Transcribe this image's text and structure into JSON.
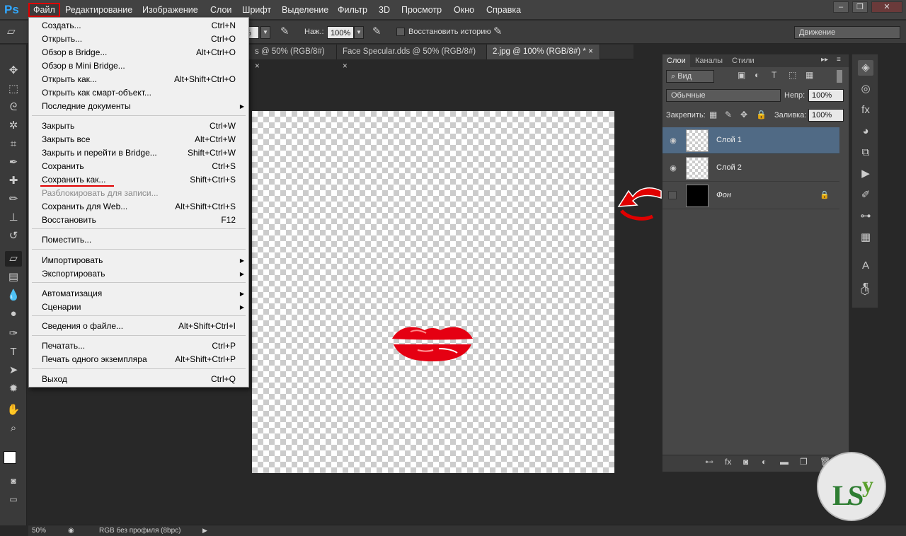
{
  "menubar": {
    "logo": "Ps",
    "items": [
      "Файл",
      "Редактирование",
      "Изображение",
      "Слои",
      "Шрифт",
      "Выделение",
      "Фильтр",
      "3D",
      "Просмотр",
      "Окно",
      "Справка"
    ]
  },
  "options": {
    "opacity_partial": "%",
    "pressure_label": "Наж.:",
    "pressure_value": "100%",
    "restore_history": "Восстановить историю",
    "workspace": "Движение"
  },
  "tabs": [
    "s @ 50% (RGB/8#)",
    "Face Specular.dds @ 50% (RGB/8#)",
    "2.jpg @ 100% (RGB/8#) *"
  ],
  "file_menu": {
    "items": [
      {
        "label": "Создать...",
        "shortcut": "Ctrl+N"
      },
      {
        "label": "Открыть...",
        "shortcut": "Ctrl+O"
      },
      {
        "label": "Обзор в Bridge...",
        "shortcut": "Alt+Ctrl+O"
      },
      {
        "label": "Обзор в Mini Bridge...",
        "shortcut": ""
      },
      {
        "label": "Открыть как...",
        "shortcut": "Alt+Shift+Ctrl+O"
      },
      {
        "label": "Открыть как смарт-объект...",
        "shortcut": ""
      },
      {
        "label": "Последние документы",
        "shortcut": ""
      },
      {
        "label": "Закрыть",
        "shortcut": "Ctrl+W"
      },
      {
        "label": "Закрыть все",
        "shortcut": "Alt+Ctrl+W"
      },
      {
        "label": "Закрыть и перейти в Bridge...",
        "shortcut": "Shift+Ctrl+W"
      },
      {
        "label": "Сохранить",
        "shortcut": "Ctrl+S"
      },
      {
        "label": "Сохранить как...",
        "shortcut": "Shift+Ctrl+S"
      },
      {
        "label": "Разблокировать для записи...",
        "shortcut": ""
      },
      {
        "label": "Сохранить для Web...",
        "shortcut": "Alt+Shift+Ctrl+S"
      },
      {
        "label": "Восстановить",
        "shortcut": "F12"
      },
      {
        "label": "Поместить...",
        "shortcut": ""
      },
      {
        "label": "Импортировать",
        "shortcut": ""
      },
      {
        "label": "Экспортировать",
        "shortcut": ""
      },
      {
        "label": "Автоматизация",
        "shortcut": ""
      },
      {
        "label": "Сценарии",
        "shortcut": ""
      },
      {
        "label": "Сведения о файле...",
        "shortcut": "Alt+Shift+Ctrl+I"
      },
      {
        "label": "Печатать...",
        "shortcut": "Ctrl+P"
      },
      {
        "label": "Печать одного экземпляра",
        "shortcut": "Alt+Shift+Ctrl+P"
      },
      {
        "label": "Выход",
        "shortcut": "Ctrl+Q"
      }
    ]
  },
  "layers_panel": {
    "tabs": [
      "Слои",
      "Каналы",
      "Стили"
    ],
    "filter": "Вид",
    "blend_mode": "Обычные",
    "opacity_label": "Непр:",
    "opacity_value": "100%",
    "lock_label": "Закрепить:",
    "fill_label": "Заливка:",
    "fill_value": "100%",
    "layers": [
      {
        "name": "Слой 1",
        "selected": true
      },
      {
        "name": "Слой 2",
        "selected": false
      },
      {
        "name": "Фон",
        "selected": false
      }
    ]
  },
  "status": {
    "zoom": "50%",
    "profile": "RGB без профиля (8bpc)"
  },
  "colors": {
    "accent_red": "#e00000",
    "selected_layer": "#506a85"
  }
}
